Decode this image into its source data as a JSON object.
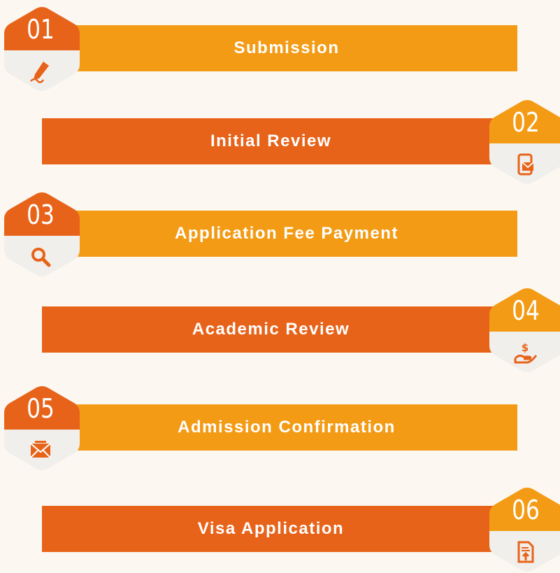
{
  "colors": {
    "background": "#fcf7f1",
    "step_light": "#f39b15",
    "step_dark": "#e8631a",
    "badge_bottom": "#f1efec",
    "text": "#ffffff"
  },
  "steps": [
    {
      "number": "01",
      "label": "Submission",
      "icon": "pen-signature-icon"
    },
    {
      "number": "02",
      "label": "Initial Review",
      "icon": "mobile-mail-icon"
    },
    {
      "number": "03",
      "label": "Application Fee Payment",
      "icon": "magnifier-icon"
    },
    {
      "number": "04",
      "label": "Academic Review",
      "icon": "hand-dollar-icon"
    },
    {
      "number": "05",
      "label": "Admission Confirmation",
      "icon": "email-icon"
    },
    {
      "number": "06",
      "label": "Visa Application",
      "icon": "document-upload-icon"
    }
  ]
}
